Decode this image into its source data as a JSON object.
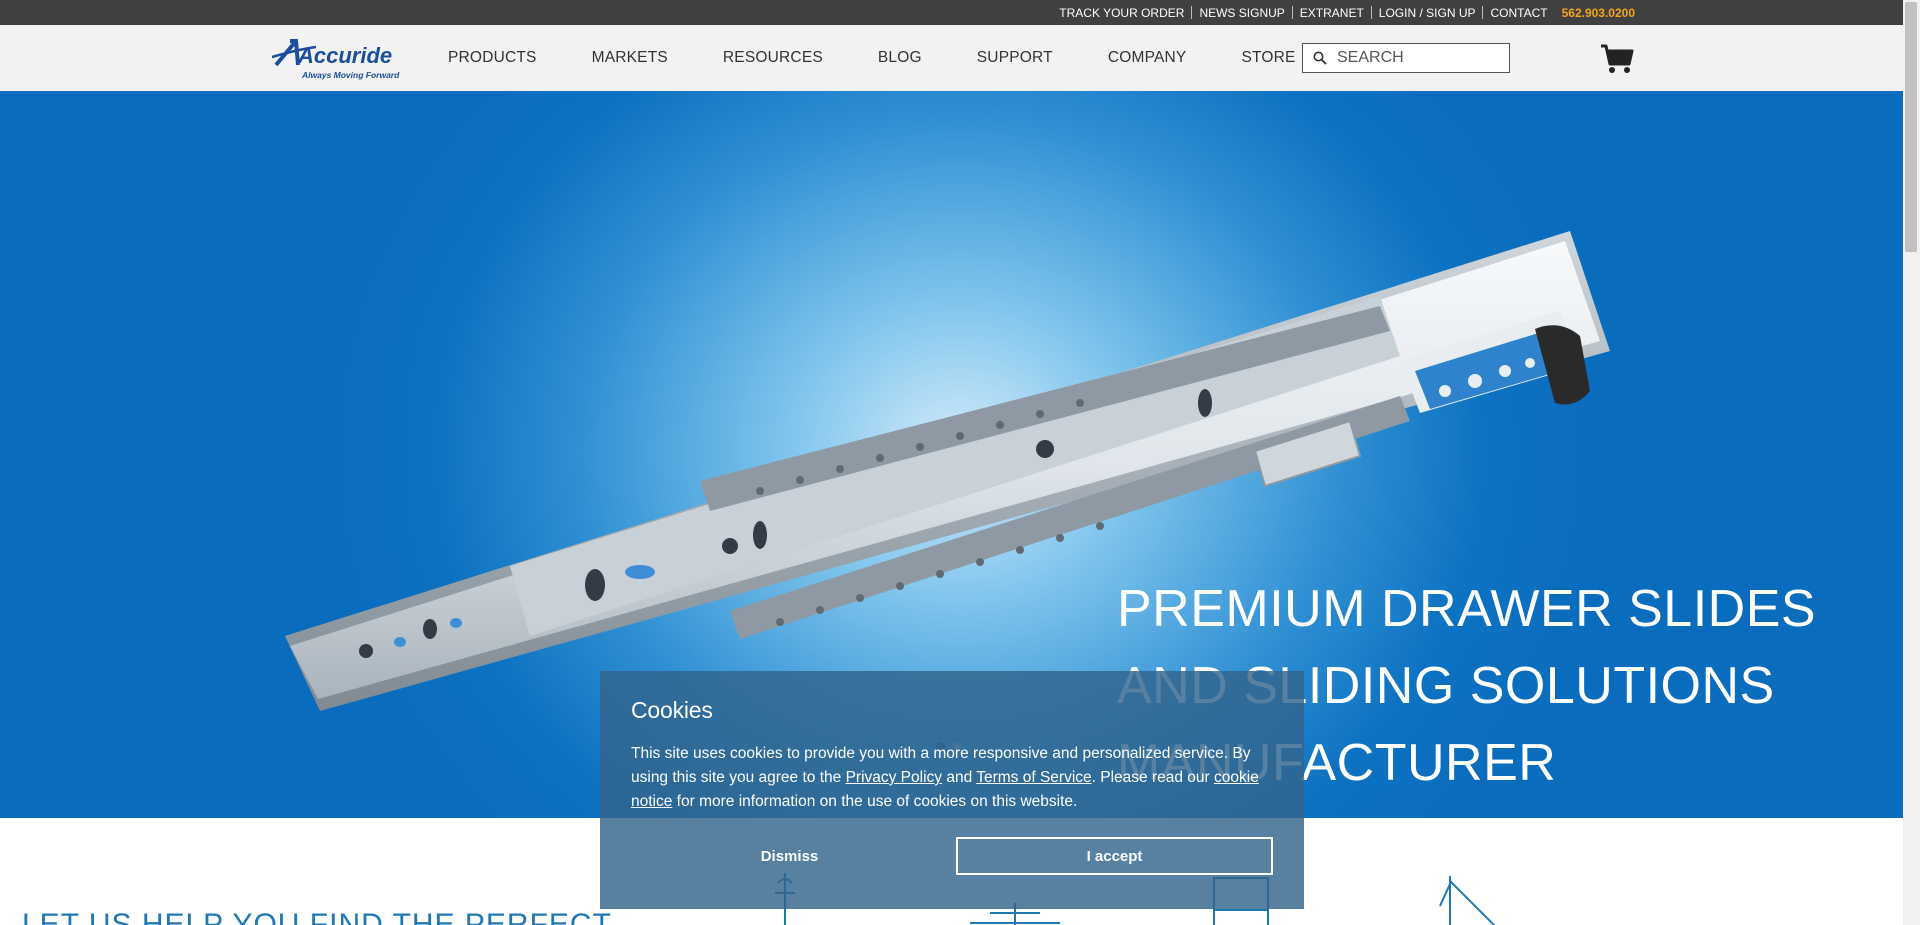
{
  "utility_bar": {
    "links": [
      "TRACK YOUR ORDER",
      "NEWS SIGNUP",
      "EXTRANET",
      "LOGIN / SIGN UP",
      "CONTACT"
    ],
    "phone": "562.903.0200",
    "phone_color": "#f4a61c"
  },
  "header": {
    "logo": {
      "brand": "Accuride",
      "tagline": "Always Moving Forward"
    },
    "nav": [
      "PRODUCTS",
      "MARKETS",
      "RESOURCES",
      "BLOG",
      "SUPPORT",
      "COMPANY",
      "STORE"
    ],
    "search": {
      "placeholder": "SEARCH",
      "icon": "search-icon"
    },
    "cart_icon": "cart-icon"
  },
  "hero": {
    "title": "PREMIUM DRAWER SLIDES AND SLIDING SOLUTIONS MANUFACTURER",
    "background_color": "#0a6cbd",
    "carousel": {
      "slides": 2,
      "active": 1
    }
  },
  "below": {
    "heading": "LET US HELP YOU FIND THE PERFECT",
    "accent_color": "#1f78b4"
  },
  "cookie_dialog": {
    "title": "Cookies",
    "text_1": "This site uses cookies to provide you with a more responsive and personalized service. By using this site you agree to the ",
    "privacy_link": "Privacy Policy",
    "text_2": " and ",
    "terms_link": "Terms of Service",
    "text_3": ". Please read our ",
    "cookie_link": "cookie notice",
    "text_4": " for more information on the use of cookies on this website.",
    "dismiss_label": "Dismiss",
    "accept_label": "I accept"
  }
}
